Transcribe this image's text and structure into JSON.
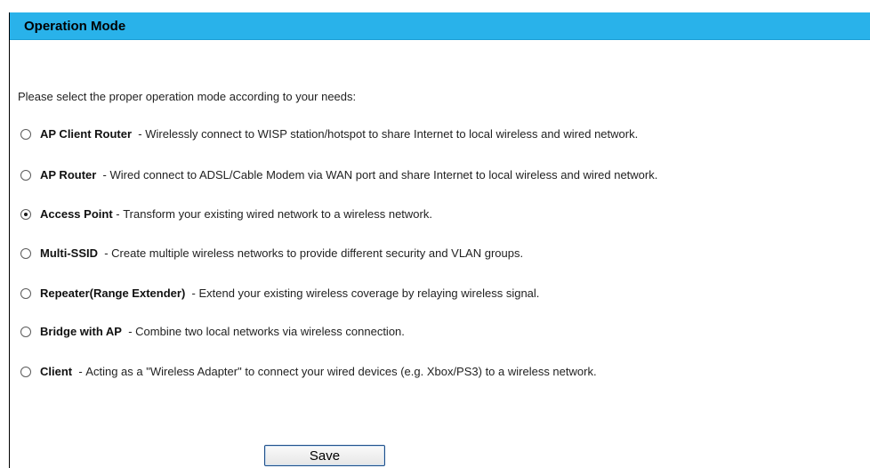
{
  "header": {
    "title": "Operation Mode"
  },
  "intro": "Please select the proper operation mode according to your needs:",
  "options": [
    {
      "name": "AP Client Router",
      "separator": "  - ",
      "description": "Wirelessly connect to WISP station/hotspot to share Internet to local wireless and wired network.",
      "selected": false
    },
    {
      "name": "AP Router",
      "separator": "  - ",
      "description": "Wired connect to ADSL/Cable Modem via WAN port and share Internet to local wireless and wired network.",
      "selected": false
    },
    {
      "name": "Access Point",
      "separator": " - ",
      "description": "Transform your existing wired network to a wireless network.",
      "selected": true
    },
    {
      "name": "Multi-SSID",
      "separator": "  - ",
      "description": "Create multiple wireless networks to provide different security and VLAN groups.",
      "selected": false
    },
    {
      "name": "Repeater(Range Extender)",
      "separator": "  - ",
      "description": "Extend your existing wireless coverage by relaying wireless signal.",
      "selected": false
    },
    {
      "name": "Bridge with AP",
      "separator": "  - ",
      "description": "Combine two local networks via wireless connection.",
      "selected": false
    },
    {
      "name": "Client",
      "separator": "  - ",
      "description": "Acting as a \"Wireless Adapter\" to connect your wired devices (e.g. Xbox/PS3) to a wireless network.",
      "selected": false
    }
  ],
  "actions": {
    "save_label": "Save"
  },
  "colors": {
    "title_bar": "#29b2ea",
    "save_border": "#1d4e89"
  }
}
